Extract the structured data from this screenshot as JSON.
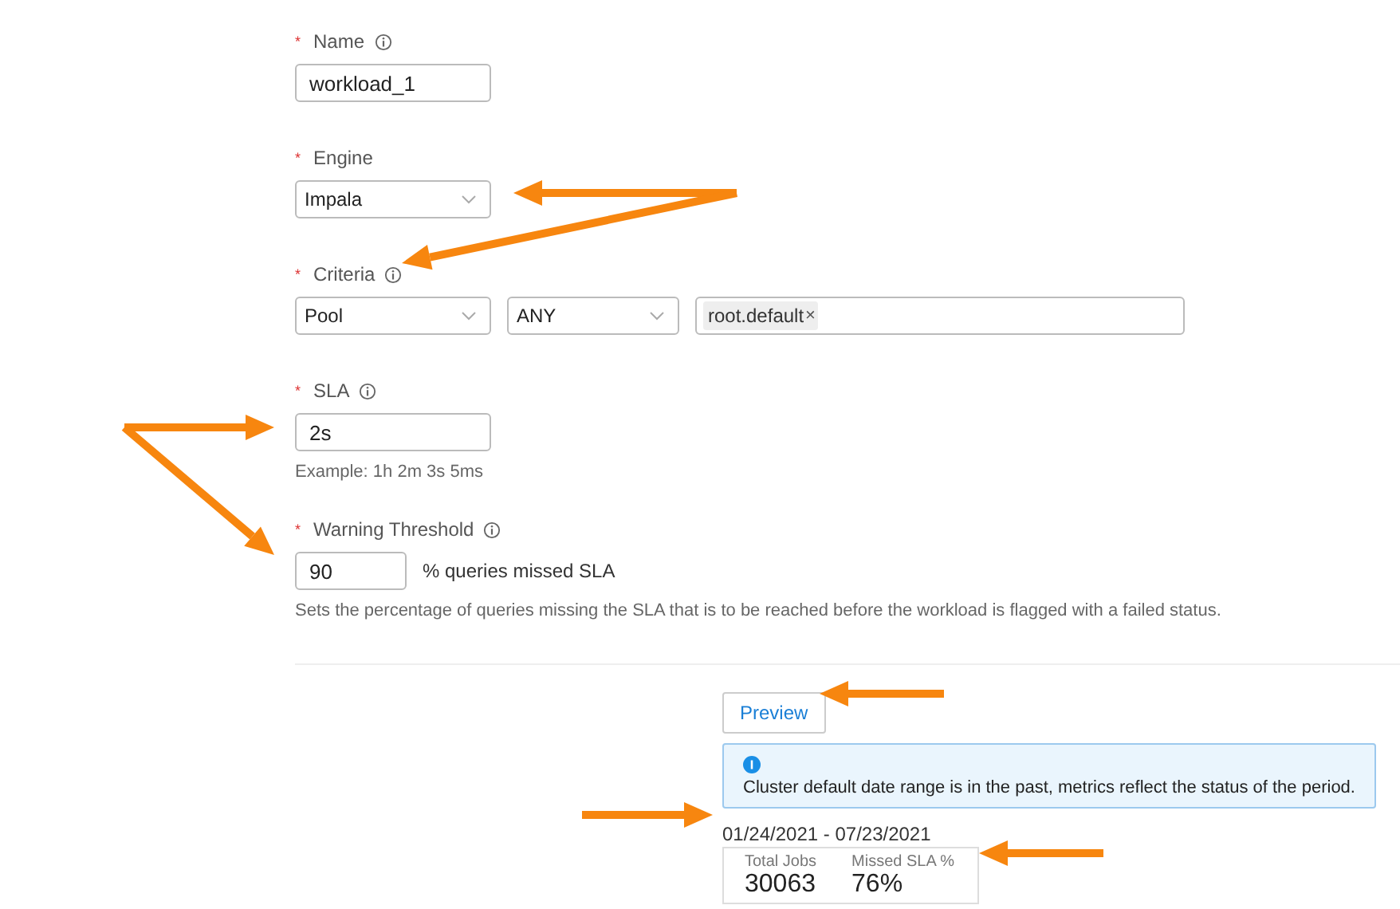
{
  "fields": [
    {
      "kind": "text",
      "mark": "*",
      "label": "Name",
      "info": true,
      "value": "workload_1"
    },
    {
      "kind": "select",
      "mark": "*",
      "label": "Engine",
      "info": false,
      "value": "Impala"
    },
    {
      "kind": "criteria",
      "mark": "*",
      "label": "Criteria",
      "info": true,
      "selects": [
        "Pool",
        "ANY"
      ],
      "tags": [
        {
          "text": "root.default",
          "remove": "×"
        }
      ]
    },
    {
      "kind": "text",
      "mark": "*",
      "label": "SLA",
      "info": true,
      "value": "2s",
      "hint": "Example: 1h 2m 3s 5ms"
    },
    {
      "kind": "threshold",
      "mark": "*",
      "label": "Warning Threshold",
      "info": true,
      "value": "90",
      "suffix": "% queries missed SLA",
      "hint": "Sets the percentage of queries missing the SLA that is to be reached before the workload is flagged with a failed status."
    }
  ],
  "preview": {
    "button": "Preview",
    "alert": "Cluster default date range is in the past, metrics reflect the status of the period.",
    "date_range": "01/24/2021 - 07/23/2021",
    "stats": [
      {
        "label": "Total Jobs",
        "value": "30063"
      },
      {
        "label": "Missed SLA %",
        "value": "76%"
      }
    ]
  }
}
